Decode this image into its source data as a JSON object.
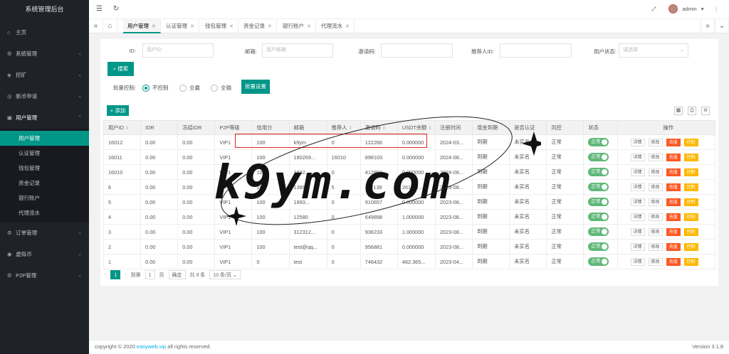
{
  "sidebar": {
    "title": "系统管理后台",
    "menu": {
      "home": "主页",
      "system": "系统管理",
      "mining": "挖矿",
      "coin_apply": "新币申请",
      "user_mgmt": "用户管理",
      "order": "订单管理",
      "virtual": "虚拟币",
      "p2p": "P2P管理"
    },
    "sub": [
      "用户管理",
      "认证管理",
      "钱包管理",
      "资金记录",
      "银行账户",
      "代理流水"
    ]
  },
  "topbar": {
    "username": "admin"
  },
  "tabs": [
    "用户管理",
    "认证管理",
    "钱包管理",
    "资金记录",
    "银行账户",
    "代理流水"
  ],
  "filters": {
    "id_label": "ID:",
    "id_placeholder": "用户ID",
    "email_label": "邮箱:",
    "email_placeholder": "用户邮箱",
    "invite_label": "邀请码:",
    "ref_label": "推荐人ID:",
    "status_label": "用户状态:",
    "status_placeholder": "请选择",
    "search_btn": "搜索"
  },
  "batch": {
    "label": "批量控制:",
    "opt1": "不控制",
    "opt2": "全赢",
    "opt3": "全输",
    "set_btn": "批量设置"
  },
  "add_btn": "添加",
  "columns": [
    "用户ID",
    "IDR",
    "冻结IDR",
    "P2P等级",
    "信用分",
    "邮箱",
    "推荐人",
    "邀请码",
    "USDT余额",
    "注册时间",
    "增金到期",
    "是否认证",
    "风控",
    "状态",
    "操作"
  ],
  "rows": [
    [
      "16012",
      "0.00",
      "0.00",
      "VIP1",
      "100",
      "k9ym",
      "0",
      "122266",
      "0.000000",
      "2024-03...",
      "到期",
      "未实名",
      "正常"
    ],
    [
      "16011",
      "0.00",
      "0.00",
      "VIP1",
      "100",
      "180269...",
      "16010",
      "898103",
      "0.000000",
      "2024-08...",
      "到期",
      "未实名",
      "正常"
    ],
    [
      "16010",
      "0.00",
      "0.00",
      "VIP1",
      "100",
      "1832...",
      "0",
      "412893",
      "0.000000",
      "2024-08...",
      "到期",
      "未实名",
      "正常"
    ],
    [
      "6",
      "0.00",
      "0.00",
      "VIP1",
      "100",
      "1389...",
      "5",
      "112138",
      "261.00...",
      "2023-08...",
      "到期",
      "未实名",
      "正常"
    ],
    [
      "5",
      "0.00",
      "0.00",
      "VIP1",
      "100",
      "1893...",
      "0",
      "910657",
      "0.000000",
      "2023-08...",
      "到期",
      "未实名",
      "正常"
    ],
    [
      "4",
      "0.00",
      "0.00",
      "VIP1",
      "100",
      "12580",
      "0",
      "649898",
      "1.000000",
      "2023-08...",
      "到期",
      "未实名",
      "正常"
    ],
    [
      "3",
      "0.00",
      "0.00",
      "VIP1",
      "100",
      "312312...",
      "0",
      "936233",
      "1.000000",
      "2023-08...",
      "到期",
      "未实名",
      "正常"
    ],
    [
      "2",
      "0.00",
      "0.00",
      "VIP1",
      "100",
      "test@qq...",
      "0",
      "956881",
      "0.000000",
      "2023-08...",
      "到期",
      "未实名",
      "正常"
    ],
    [
      "1",
      "0.00",
      "0.00",
      "VIP1",
      "0",
      "test",
      "0",
      "746432",
      "482.365...",
      "2023-04...",
      "到期",
      "未实名",
      "正常"
    ]
  ],
  "status_label": "正常",
  "actions": {
    "detail": "详情",
    "edit": "修改",
    "recharge": "充值",
    "control": "控制"
  },
  "pager": {
    "page": "1",
    "goto": "到第",
    "page_input": "1",
    "page_unit": "页",
    "confirm": "确定",
    "total": "共 9 条",
    "per_page": "10 条/页"
  },
  "footer": {
    "copyright": "copyright © 2020",
    "link": "easyweb.vip",
    "rights": "all rights reserved.",
    "version": "Version 3.1.8"
  },
  "watermark": "k9ym.com"
}
